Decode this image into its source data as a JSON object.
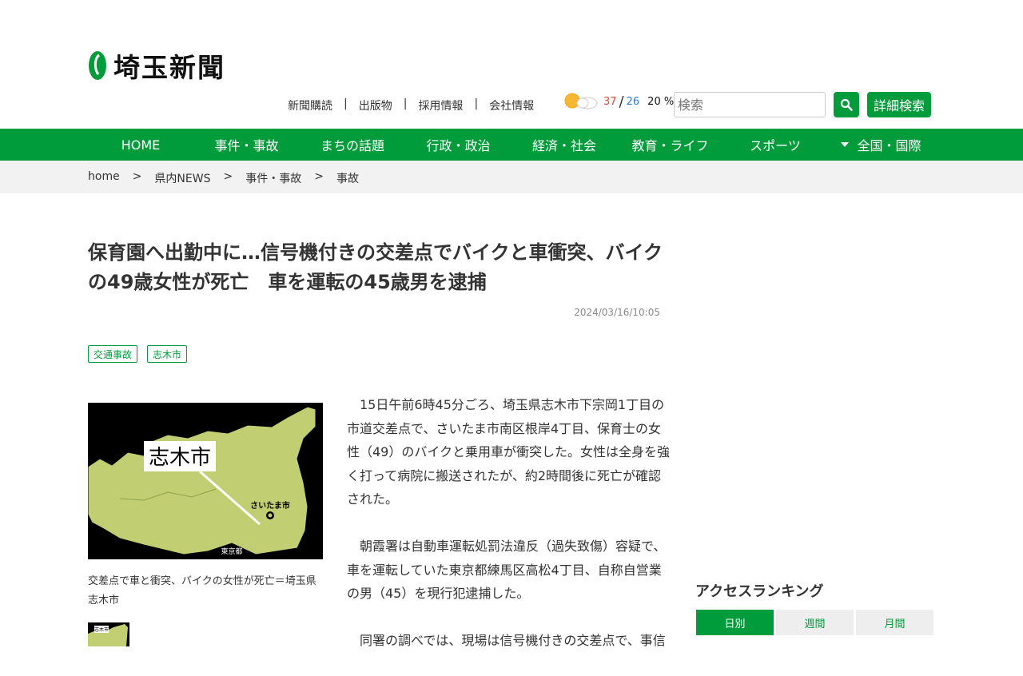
{
  "header": {
    "logo_text": "埼玉新聞",
    "util_links": [
      "新聞購読",
      "出版物",
      "採用情報",
      "会社情報"
    ],
    "util_sep": "|",
    "weather": {
      "icon": "sun-cloud-icon",
      "high": "37",
      "low": "26",
      "slash": "/",
      "precip": "20 %"
    },
    "search_placeholder": "検索",
    "detail_search_label": "詳細検索"
  },
  "nav": {
    "items": [
      "HOME",
      "事件・事故",
      "まちの話題",
      "行政・政治",
      "経済・社会",
      "教育・ライフ",
      "スポーツ",
      "全国・国際"
    ]
  },
  "breadcrumb": {
    "items": [
      "home",
      "県内NEWS",
      "事件・事故",
      "事故"
    ],
    "sep": ">"
  },
  "article": {
    "title": "保育園へ出勤中に…信号機付きの交差点でバイクと車衝突、バイクの49歳女性が死亡　車を運転の45歳男を逮捕",
    "date": "2024/03/16/10:05",
    "tags": [
      "交通事故",
      "志木市"
    ],
    "map_label_city": "志木市",
    "map_label_saitama": "さいたま市",
    "map_label_tokyo": "東京都",
    "thumb_label": "志木市",
    "caption": "交差点で車と衝突、バイクの女性が死亡＝埼玉県志木市",
    "paragraphs": [
      "　15日午前6時45分ごろ、埼玉県志木市下宗岡1丁目の市道交差点で、さいたま市南区根岸4丁目、保育士の女性（49）のバイクと乗用車が衝突した。女性は全身を強く打って病院に搬送されたが、約2時間後に死亡が確認された。",
      "　朝霞署は自動車運転処罰法違反（過失致傷）容疑で、車を運転していた東京都練馬区高松4丁目、自称自営業の男（45）を現行犯逮捕した。",
      "　同署の調べでは、現場は信号機付きの交差点で、事信"
    ]
  },
  "sidebar": {
    "ranking_title": "アクセスランキング",
    "tabs": [
      "日別",
      "週間",
      "月間"
    ]
  },
  "colors": {
    "brand_green": "#009b3a"
  }
}
